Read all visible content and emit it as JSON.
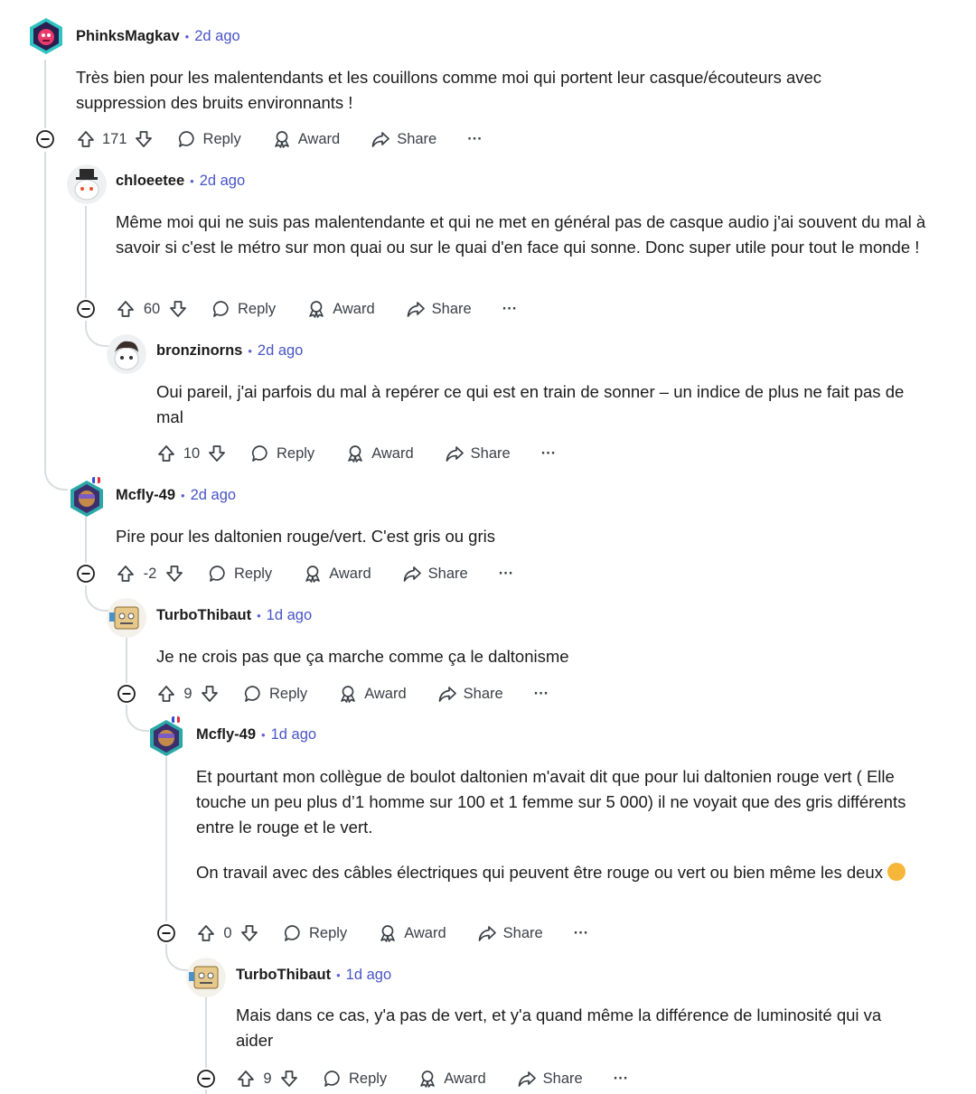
{
  "comments": [
    {
      "author": "PhinksMagkav",
      "time": "2d ago",
      "body": [
        "Très bien pour les malentendants et les couillons comme moi qui portent leur casque/écouteurs avec suppression des bruits environnants !"
      ],
      "votes": "171",
      "icon": "alien-robot-avatar"
    },
    {
      "author": "chloeetee",
      "time": "2d ago",
      "body": [
        "Même moi qui ne suis pas malentendante et qui ne met en général pas de casque audio j'ai souvent du mal à savoir si c'est le métro sur mon quai ou sur le quai d'en face qui sonne. Donc super utile pour tout le monde !"
      ],
      "votes": "60",
      "icon": "snoo-top-hat-avatar"
    },
    {
      "author": "bronzinorns",
      "time": "2d ago",
      "body": [
        "Oui pareil, j'ai parfois du mal à repérer ce qui est en train de sonner – un indice de plus ne fait pas de mal"
      ],
      "votes": "10",
      "icon": "snoo-dark-hair-avatar"
    },
    {
      "author": "Mcfly-49",
      "time": "2d ago",
      "body": [
        "Pire pour les daltonien rouge/vert. C'est gris ou gris"
      ],
      "votes": "-2",
      "icon": "hexagon-avatar"
    },
    {
      "author": "TurboThibaut",
      "time": "1d ago",
      "body": [
        "Je ne crois pas que ça marche comme ça le daltonisme"
      ],
      "votes": "9",
      "icon": "robot-box-avatar"
    },
    {
      "author": "Mcfly-49",
      "time": "1d ago",
      "body": [
        "Et pourtant mon collègue de boulot daltonien m'avait dit que pour lui daltonien rouge vert ( Elle touche un peu plus d’1 homme sur 100 et 1 femme sur 5 000) il ne voyait que des gris différents entre le rouge et le vert.",
        "On travail avec des câbles électriques qui peuvent être rouge ou vert ou bien même les deux"
      ],
      "votes": "0",
      "icon": "hexagon-avatar"
    },
    {
      "author": "TurboThibaut",
      "time": "1d ago",
      "body": [
        "Mais dans ce cas, y'a pas de vert, et y'a quand même la différence de luminosité qui va aider"
      ],
      "votes": "9",
      "icon": "robot-box-avatar"
    }
  ],
  "labels": {
    "reply": "Reply",
    "award": "Award",
    "share": "Share",
    "more": "···",
    "dot": "•"
  },
  "emoji": "smiling-face-sweat-emoji",
  "colors": {
    "link": "#4854c7",
    "thread": "#d9dde1",
    "text": "#1c1c1c"
  }
}
